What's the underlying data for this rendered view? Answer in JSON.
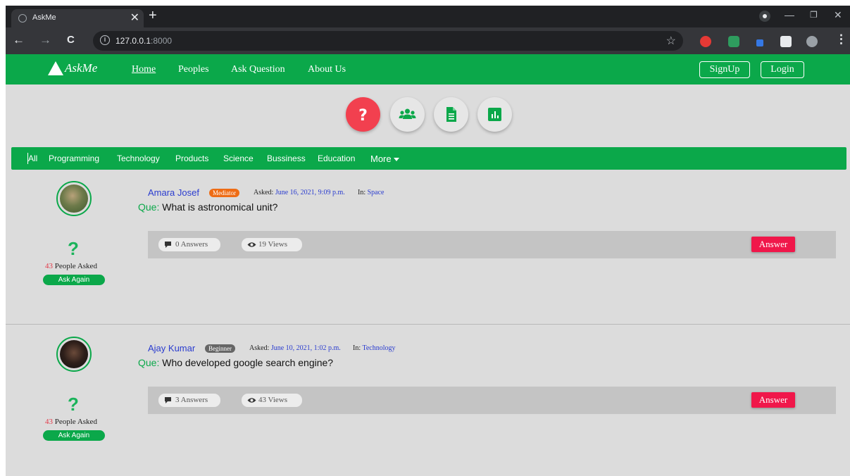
{
  "browser": {
    "tab_title": "AskMe",
    "close_glyph": "✕",
    "newtab_glyph": "+",
    "url_host": "127.0.0.1",
    "url_port": ":8000",
    "nav_back": "←",
    "nav_forward": "→",
    "reload": "C",
    "info_glyph": "i",
    "star_glyph": "☆",
    "min_glyph": "—",
    "max_glyph": "❐",
    "win_close_glyph": "✕",
    "menu_glyph": "⋮",
    "extensions": [
      "adblock-icon",
      "mail-extension-icon",
      "extension-pen-icon",
      "extensions-puzzle-icon",
      "profile-avatar-icon"
    ]
  },
  "site": {
    "logo_text": "AskMe",
    "nav": [
      {
        "label": "Home",
        "active": true
      },
      {
        "label": "Peoples"
      },
      {
        "label": "Ask Question"
      },
      {
        "label": "About Us"
      }
    ],
    "signup_label": "SignUp",
    "login_label": "Login"
  },
  "quick_actions": [
    "question-icon",
    "people-icon",
    "document-icon",
    "chart-icon"
  ],
  "categories": {
    "items": [
      "All",
      "Programming",
      "Technology",
      "Products",
      "Science",
      "Bussiness",
      "Education"
    ],
    "more_label": "More"
  },
  "colors": {
    "brand_green": "#0ba84a",
    "answer_red": "#f0174a",
    "mediator_orange": "#ee6c15",
    "link_blue": "#2a3ccf"
  },
  "questions": [
    {
      "author": "Amara Josef",
      "badge": "Mediator",
      "asked_label": "Asked:",
      "asked_date": "June 16, 2021, 9:09 p.m.",
      "in_label": "In:",
      "category": "Space",
      "que_label": "Que:",
      "question": "What is astronomical unit?",
      "answers": "0 Answers",
      "views": "19 Views",
      "answer_btn": "Answer",
      "people_asked_num": "43",
      "people_asked_text": "People Asked",
      "ask_again": "Ask Again"
    },
    {
      "author": "Ajay Kumar",
      "badge": "Beginner",
      "asked_label": "Asked:",
      "asked_date": "June 10, 2021, 1:02 p.m.",
      "in_label": "In:",
      "category": "Technology",
      "que_label": "Que:",
      "question": "Who developed google search engine?",
      "answers": "3 Answers",
      "views": "43 Views",
      "answer_btn": "Answer",
      "people_asked_num": "43",
      "people_asked_text": "People Asked",
      "ask_again": "Ask Again"
    }
  ]
}
